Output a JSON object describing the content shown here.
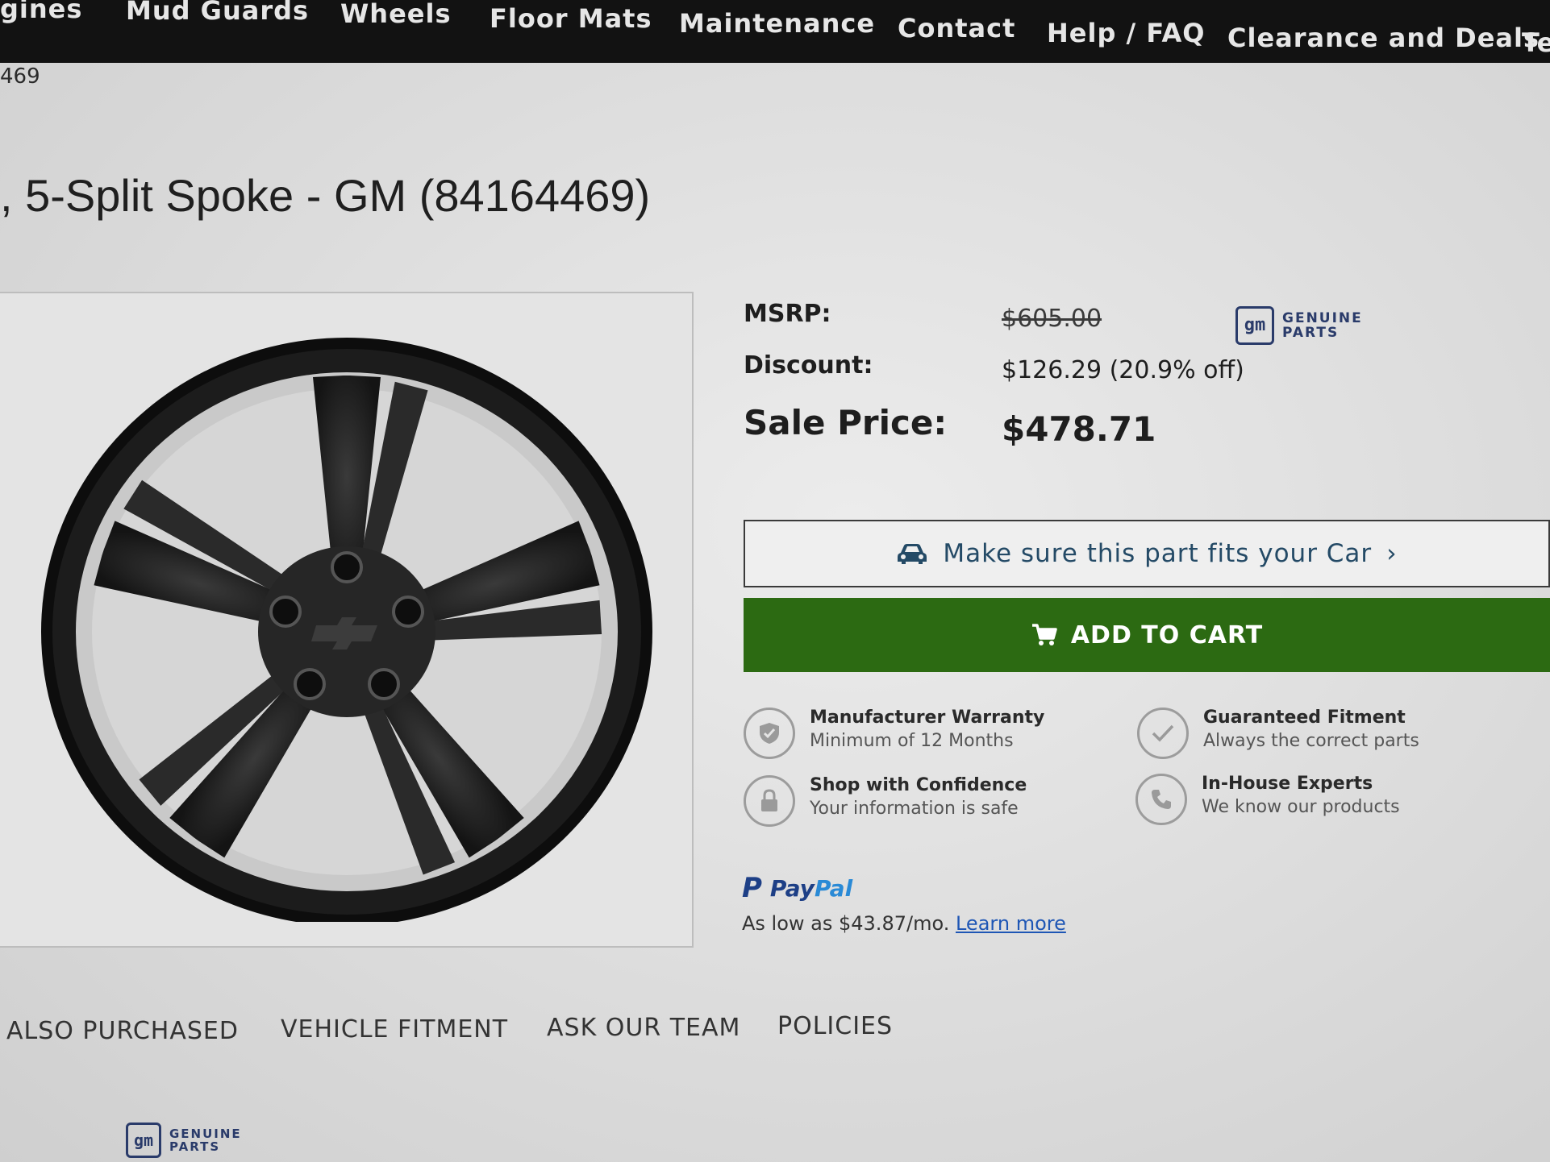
{
  "nav": {
    "items": [
      "gines",
      "Mud Guards",
      "Wheels",
      "Floor Mats",
      "Maintenance",
      "Contact",
      "Help / FAQ",
      "Clearance and Deals",
      "Te"
    ]
  },
  "breadcrumb": "469",
  "product": {
    "title": ", 5-Split Spoke - GM (84164469)"
  },
  "pricing": {
    "msrp_label": "MSRP:",
    "msrp_value": "$605.00",
    "discount_label": "Discount:",
    "discount_value": "$126.29 (20.9% off)",
    "sale_label": "Sale Price:",
    "sale_value": "$478.71"
  },
  "badge": {
    "logo": "gm",
    "line1": "GENUINE",
    "line2": "PARTS"
  },
  "actions": {
    "fit_label": "Make sure this part fits your Car",
    "fit_chevron": "›",
    "add_to_cart_label": "ADD TO CART"
  },
  "features": [
    {
      "title": "Manufacturer Warranty",
      "subtitle": "Minimum of 12 Months",
      "icon": "shield-check-icon"
    },
    {
      "title": "Guaranteed Fitment",
      "subtitle": "Always the correct parts",
      "icon": "checkmark-icon"
    },
    {
      "title": "Shop with Confidence",
      "subtitle": "Your information is safe",
      "icon": "lock-icon"
    },
    {
      "title": "In-House Experts",
      "subtitle": "We know our products",
      "icon": "phone-icon"
    }
  ],
  "paypal": {
    "brand_a": "Pay",
    "brand_b": "Pal",
    "text": "As low as $43.87/mo.",
    "link": "Learn more"
  },
  "tabs": [
    "ALSO PURCHASED",
    "VEHICLE FITMENT",
    "ASK OUR TEAM",
    "POLICIES"
  ],
  "colors": {
    "nav_bg": "#121212",
    "cart_green": "#2c6a12",
    "link_blue": "#1e56b5",
    "gm_blue": "#2a3b6a"
  }
}
